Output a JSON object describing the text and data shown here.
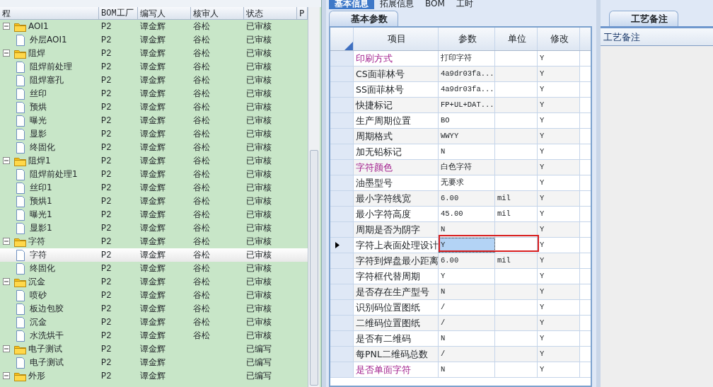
{
  "left_panel": {
    "columns": [
      "程",
      "BOM工厂",
      "编写人",
      "核审人",
      "状态",
      "P"
    ],
    "tree": [
      {
        "name": "AOI1",
        "bom": "P2",
        "author": "谭金辉",
        "reviewer": "谷松",
        "status": "已审核",
        "expanded": true,
        "selected": false,
        "children": [
          {
            "name": "外层AOI1",
            "bom": "P2",
            "author": "谭金辉",
            "reviewer": "谷松",
            "status": "已审核",
            "selected": false
          }
        ]
      },
      {
        "name": "阻焊",
        "bom": "P2",
        "author": "谭金辉",
        "reviewer": "谷松",
        "status": "已审核",
        "expanded": true,
        "selected": false,
        "children": [
          {
            "name": "阻焊前处理",
            "bom": "P2",
            "author": "谭金辉",
            "reviewer": "谷松",
            "status": "已审核",
            "selected": false
          },
          {
            "name": "阻焊塞孔",
            "bom": "P2",
            "author": "谭金辉",
            "reviewer": "谷松",
            "status": "已审核",
            "selected": false
          },
          {
            "name": "丝印",
            "bom": "P2",
            "author": "谭金辉",
            "reviewer": "谷松",
            "status": "已审核",
            "selected": false
          },
          {
            "name": "预烘",
            "bom": "P2",
            "author": "谭金辉",
            "reviewer": "谷松",
            "status": "已审核",
            "selected": false
          },
          {
            "name": "曝光",
            "bom": "P2",
            "author": "谭金辉",
            "reviewer": "谷松",
            "status": "已审核",
            "selected": false
          },
          {
            "name": "显影",
            "bom": "P2",
            "author": "谭金辉",
            "reviewer": "谷松",
            "status": "已审核",
            "selected": false
          },
          {
            "name": "终固化",
            "bom": "P2",
            "author": "谭金辉",
            "reviewer": "谷松",
            "status": "已审核",
            "selected": false
          }
        ]
      },
      {
        "name": "阻焊1",
        "bom": "P2",
        "author": "谭金辉",
        "reviewer": "谷松",
        "status": "已审核",
        "expanded": true,
        "selected": false,
        "children": [
          {
            "name": "阻焊前处理1",
            "bom": "P2",
            "author": "谭金辉",
            "reviewer": "谷松",
            "status": "已审核",
            "selected": false
          },
          {
            "name": "丝印1",
            "bom": "P2",
            "author": "谭金辉",
            "reviewer": "谷松",
            "status": "已审核",
            "selected": false
          },
          {
            "name": "预烘1",
            "bom": "P2",
            "author": "谭金辉",
            "reviewer": "谷松",
            "status": "已审核",
            "selected": false
          },
          {
            "name": "曝光1",
            "bom": "P2",
            "author": "谭金辉",
            "reviewer": "谷松",
            "status": "已审核",
            "selected": false
          },
          {
            "name": "显影1",
            "bom": "P2",
            "author": "谭金辉",
            "reviewer": "谷松",
            "status": "已审核",
            "selected": false
          }
        ]
      },
      {
        "name": "字符",
        "bom": "P2",
        "author": "谭金辉",
        "reviewer": "谷松",
        "status": "已审核",
        "expanded": true,
        "selected": false,
        "children": [
          {
            "name": "字符",
            "bom": "P2",
            "author": "谭金辉",
            "reviewer": "谷松",
            "status": "已审核",
            "selected": true
          },
          {
            "name": "终固化",
            "bom": "P2",
            "author": "谭金辉",
            "reviewer": "谷松",
            "status": "已审核",
            "selected": false
          }
        ]
      },
      {
        "name": "沉金",
        "bom": "P2",
        "author": "谭金辉",
        "reviewer": "谷松",
        "status": "已审核",
        "expanded": true,
        "selected": false,
        "children": [
          {
            "name": "喷砂",
            "bom": "P2",
            "author": "谭金辉",
            "reviewer": "谷松",
            "status": "已审核",
            "selected": false
          },
          {
            "name": "板边包胶",
            "bom": "P2",
            "author": "谭金辉",
            "reviewer": "谷松",
            "status": "已审核",
            "selected": false
          },
          {
            "name": "沉金",
            "bom": "P2",
            "author": "谭金辉",
            "reviewer": "谷松",
            "status": "已审核",
            "selected": false
          },
          {
            "name": "水洗烘干",
            "bom": "P2",
            "author": "谭金辉",
            "reviewer": "谷松",
            "status": "已审核",
            "selected": false
          }
        ]
      },
      {
        "name": "电子测试",
        "bom": "P2",
        "author": "谭金辉",
        "status": "已编写",
        "expanded": true,
        "selected": false,
        "children": [
          {
            "name": "电子测试",
            "bom": "P2",
            "author": "谭金辉",
            "status": "已编写",
            "selected": false
          }
        ]
      },
      {
        "name": "外形",
        "bom": "P2",
        "author": "谭金辉",
        "status": "已编写",
        "expanded": true,
        "selected": false
      }
    ]
  },
  "top_tabs": [
    {
      "label": "基本信息",
      "selected": true
    },
    {
      "label": "拓展信息",
      "selected": false
    },
    {
      "label": "BOM",
      "selected": false
    },
    {
      "label": "工时",
      "selected": false
    }
  ],
  "sub_tab": {
    "label": "基本参数"
  },
  "grid": {
    "columns": [
      "项目",
      "参数",
      "单位",
      "修改"
    ],
    "rows": [
      {
        "item": "印刷方式",
        "value": "打印字符",
        "modify": "Y",
        "highlighted": true,
        "selected": false,
        "annotated": false
      },
      {
        "item": "CS面菲林号",
        "value": "4a9dr03fa...",
        "modify": "Y",
        "highlighted": false,
        "selected": false,
        "annotated": false
      },
      {
        "item": "SS面菲林号",
        "value": "4a9dr03fa...",
        "modify": "Y",
        "highlighted": false,
        "selected": false,
        "annotated": false
      },
      {
        "item": "快捷标记",
        "value": "FP+UL+DAT...",
        "modify": "Y",
        "highlighted": false,
        "selected": false,
        "annotated": false
      },
      {
        "item": "生产周期位置",
        "value": "BO",
        "modify": "Y",
        "highlighted": false,
        "selected": false,
        "annotated": false
      },
      {
        "item": "周期格式",
        "value": "WWYY",
        "modify": "Y",
        "highlighted": false,
        "selected": false,
        "annotated": false
      },
      {
        "item": "加无铅标记",
        "value": "N",
        "modify": "Y",
        "highlighted": false,
        "selected": false,
        "annotated": false
      },
      {
        "item": "字符颜色",
        "value": "白色字符",
        "modify": "Y",
        "highlighted": true,
        "selected": false,
        "annotated": false
      },
      {
        "item": "油墨型号",
        "value": "无要求",
        "modify": "Y",
        "highlighted": false,
        "selected": false,
        "annotated": false
      },
      {
        "item": "最小字符线宽",
        "value": "6.00",
        "unit": "mil",
        "modify": "Y",
        "highlighted": false,
        "selected": false,
        "annotated": false
      },
      {
        "item": "最小字符高度",
        "value": "45.00",
        "unit": "mil",
        "modify": "Y",
        "highlighted": false,
        "selected": false,
        "annotated": false
      },
      {
        "item": "周期是否为阴字",
        "value": "N",
        "modify": "Y",
        "highlighted": false,
        "selected": false,
        "annotated": false
      },
      {
        "item": "字符上表面处理设计",
        "value": "Y",
        "modify": "Y",
        "highlighted": false,
        "selected": true,
        "annotated": true
      },
      {
        "item": "字符到焊盘最小距离",
        "value": "6.00",
        "unit": "mil",
        "modify": "Y",
        "highlighted": false,
        "selected": false,
        "annotated": false
      },
      {
        "item": "字符框代替周期",
        "value": "Y",
        "modify": "Y",
        "highlighted": false,
        "selected": false,
        "annotated": false
      },
      {
        "item": "是否存在生产型号",
        "value": "N",
        "modify": "Y",
        "highlighted": false,
        "selected": false,
        "annotated": false
      },
      {
        "item": "识别码位置图纸",
        "value": "/",
        "modify": "Y",
        "highlighted": false,
        "selected": false,
        "annotated": false
      },
      {
        "item": "二维码位置图纸",
        "value": "/",
        "modify": "Y",
        "highlighted": false,
        "selected": false,
        "annotated": false
      },
      {
        "item": "是否有二维码",
        "value": "N",
        "modify": "Y",
        "highlighted": false,
        "selected": false,
        "annotated": false
      },
      {
        "item": "每PNL二维码总数",
        "value": "/",
        "modify": "Y",
        "highlighted": false,
        "selected": false,
        "annotated": false
      },
      {
        "item": "是否单面字符",
        "value": "N",
        "modify": "Y",
        "highlighted": true,
        "selected": false,
        "annotated": false
      }
    ]
  },
  "right_panel": {
    "tab": {
      "label": "工艺备注"
    },
    "header": "工艺备注"
  }
}
